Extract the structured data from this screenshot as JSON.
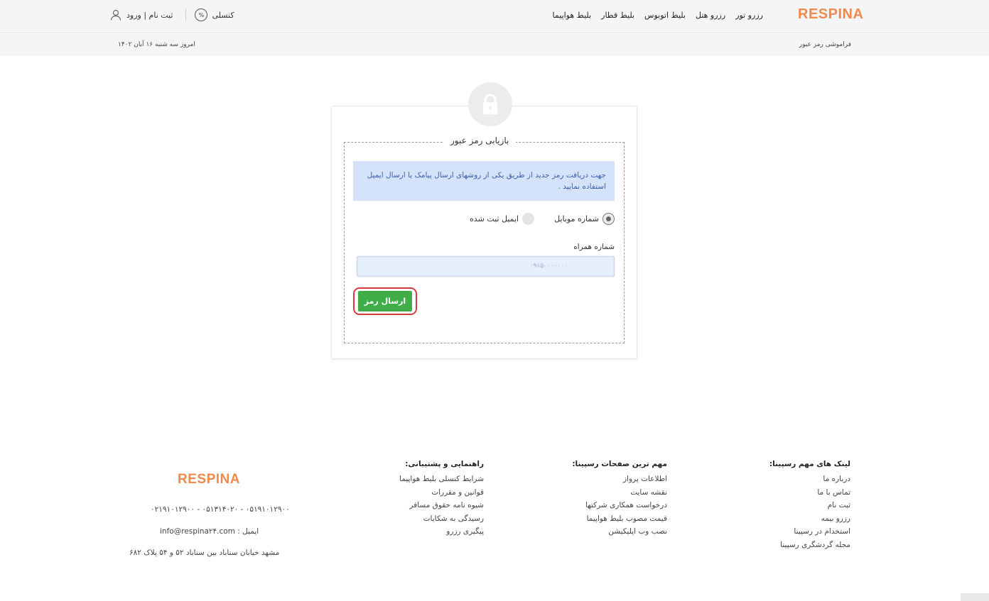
{
  "header": {
    "logo": "RESPINA",
    "nav": [
      "بلیط هواپیما",
      "بلیط قطار",
      "بلیط اتوبوس",
      "رزرو هتل",
      "رزرو تور"
    ],
    "cancel_label": "کنسلی",
    "cancel_icon": "%",
    "auth_label": "ثبت نام | ورود"
  },
  "subbar": {
    "breadcrumb": "فراموشی رمز عبور",
    "date": "امروز سه شنبه ۱۶ آبان ۱۴۰۲"
  },
  "form": {
    "legend": "بازیابی رمز عبور",
    "info": "جهت دریافت رمز جدید از طریق یکی از روشهای ارسال پیامک یا ارسال ایمیل استفاده نمایید .",
    "radio_mobile": "شماره موبایل",
    "radio_email": "ایمیل ثبت شده",
    "selected": "mobile",
    "phone_label": "شماره همراه",
    "phone_value": "۰۹۱۵۰۰۰۰۰۰۰",
    "submit_label": "ارسال رمز"
  },
  "footer": {
    "col1": {
      "title": "لینک های مهم رسپینا:",
      "links": [
        "درباره ما",
        "تماس با ما",
        "ثبت نام",
        "رزرو بیمه",
        "استخدام در رسپینا",
        "مجله گردشگری رسپینا"
      ]
    },
    "col2": {
      "title": "مهم ترین صفحات رسپینا:",
      "links": [
        "اطلاعات پرواز",
        "نقشه سایت",
        "درخواست همکاری شرکتها",
        "قیمت مصوب بلیط هواپیما",
        "نصب وب اپلیکیشن"
      ]
    },
    "col3": {
      "title": "راهنمایی و پشتیبانی:",
      "links": [
        "شرایط کنسلی بلیط هواپیما",
        "قوانین و مقررات",
        "شیوه نامه حقوق مسافر",
        "رسیدگی به شکایات",
        "پیگیری رزرو"
      ]
    },
    "logo": "RESPINA",
    "phones": "۰۲۱۹۱۰۱۲۹۰۰ - ۰۵۱۳۱۴۰۲۰ - ۰۵۱۹۱۰۱۲۹۰۰",
    "email": "ایمیل : info@respina۲۴.com",
    "address": "مشهد خیابان سناباد بین سناباد ۵۲ و ۵۴ پلاک ۶۸۲"
  },
  "colors": {
    "brand": "#f08a4b",
    "submit": "#3fae48",
    "highlight": "#d63b3b",
    "info_bg": "#d4e3fa"
  }
}
